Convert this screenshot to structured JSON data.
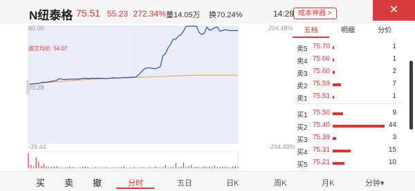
{
  "header": {
    "stock_name": "N纽泰格",
    "price": "75.51",
    "change": "55.23",
    "change_pct": "272.34%",
    "volume": "量14.05万",
    "turnover": "换70.24%",
    "time": "14:29",
    "tool_button": "成本神器 >",
    "close_icon": "close-icon"
  },
  "chart": {
    "left_top": "80.00",
    "left_mid": "20.28",
    "left_bottom": "-39.44",
    "right_top": "294.48%",
    "right_bottom": "-294.48%",
    "avg_label": "成交均价: 54.07"
  },
  "chart_data": {
    "type": "line",
    "title": "",
    "xlabel": "",
    "ylabel": "",
    "ylim": [
      -39.44,
      80.0
    ],
    "series": [
      {
        "values": [
          21.0,
          21.0,
          21.2,
          21.5,
          21.8,
          22.5,
          23.0,
          22.8,
          23.4,
          23.8,
          24.3,
          25.0,
          26.5,
          26.0,
          25.5,
          25.8,
          26.0,
          26.1,
          26.0,
          26.2,
          26.3,
          26.8,
          27.0,
          26.5,
          26.9,
          27.0,
          26.7,
          27.0,
          26.8,
          26.9,
          26.6,
          26.9,
          27.2,
          27.6,
          27.2,
          27.4,
          27.5,
          27.8,
          27.6,
          27.9,
          28.0,
          27.9,
          29.0,
          31.5,
          34.5,
          36.8,
          37.5,
          37.5,
          37.0,
          36.5,
          37.5,
          38.8,
          50.0,
          52.0,
          58.0,
          61.5,
          66.8,
          66.8,
          70.0,
          71.2,
          75.0,
          80.0,
          80.0,
          80.0,
          80.0,
          80.0,
          73.5,
          71.5,
          73.0,
          79.0,
          76.0,
          76.8,
          78.5,
          79.0,
          75.0,
          75.5,
          76.5,
          76.0,
          75.5,
          75.6,
          75.5,
          75.51
        ]
      },
      {
        "values": [
          21.0,
          21.2,
          21.5,
          21.8,
          22.0,
          22.2,
          22.4,
          22.6,
          22.8,
          23.0,
          23.2,
          23.4,
          23.6,
          23.8,
          24.0,
          24.2,
          24.4,
          24.6,
          24.8,
          25.0,
          25.2,
          25.4,
          25.6,
          25.8,
          26.0,
          26.1,
          26.2,
          26.3,
          26.4,
          26.5,
          26.6,
          26.7,
          26.8,
          26.9,
          27.0,
          27.1,
          27.2,
          27.3,
          27.4,
          27.5,
          27.6,
          27.7,
          27.8,
          27.9,
          28.0,
          28.1,
          28.2,
          28.3,
          28.4,
          28.5,
          28.6,
          28.7,
          28.8,
          28.9,
          29.0,
          29.1,
          29.2,
          29.3,
          29.4,
          29.5,
          29.6,
          29.7,
          29.8,
          29.9,
          30.0,
          30.0,
          30.0,
          30.0,
          30.0,
          30.0,
          30.0,
          30.0,
          30.0,
          30.0,
          30.0,
          30.0,
          30.0,
          30.0,
          30.0,
          30.0,
          30.0,
          30.0
        ]
      }
    ],
    "volume": [
      28,
      6,
      3,
      20,
      12,
      4,
      8,
      3,
      2,
      2,
      3,
      4,
      2,
      1,
      1,
      2,
      3,
      2,
      1,
      1,
      1,
      2,
      3,
      2,
      1,
      1,
      2,
      1,
      1,
      1,
      2,
      1,
      1,
      2,
      1,
      1,
      2,
      3,
      1,
      1,
      1,
      2,
      1,
      1,
      2,
      1,
      1,
      2,
      1,
      3,
      1,
      1,
      2,
      6,
      1,
      2,
      2,
      10,
      2,
      3,
      11,
      2,
      4,
      6,
      2,
      3,
      2,
      2,
      3,
      2,
      3,
      2,
      5,
      2,
      2,
      3,
      2,
      2,
      2,
      3,
      4,
      2
    ]
  },
  "book": {
    "tabs": [
      "五档",
      "明细",
      "分价"
    ],
    "asks": [
      {
        "label": "卖5",
        "price": "75.70",
        "qty": "1",
        "bar": 1
      },
      {
        "label": "卖4",
        "price": "75.66",
        "qty": "1",
        "bar": 1
      },
      {
        "label": "卖3",
        "price": "75.60",
        "qty": "2",
        "bar": 2
      },
      {
        "label": "卖2",
        "price": "75.59",
        "qty": "7",
        "bar": 7
      },
      {
        "label": "卖1",
        "price": "75.51",
        "qty": "1",
        "bar": 1
      }
    ],
    "bids": [
      {
        "label": "买1",
        "price": "75.50",
        "qty": "9",
        "bar": 9
      },
      {
        "label": "买2",
        "price": "75.40",
        "qty": "44",
        "bar": 44
      },
      {
        "label": "买3",
        "price": "75.39",
        "qty": "3",
        "bar": 3
      },
      {
        "label": "买4",
        "price": "75.31",
        "qty": "15",
        "bar": 15
      },
      {
        "label": "买5",
        "price": "75.21",
        "qty": "10",
        "bar": 10
      }
    ]
  },
  "bottom": {
    "actions": [
      "买",
      "卖",
      "撤"
    ],
    "period_tabs": [
      "分时",
      "五日",
      "日K",
      "周K",
      "月K",
      "分钟▾"
    ]
  },
  "colors": {
    "red": "#e93030",
    "green": "#2a9a3a",
    "line": "#2a4ea8",
    "fill": "#e8ecfb"
  }
}
